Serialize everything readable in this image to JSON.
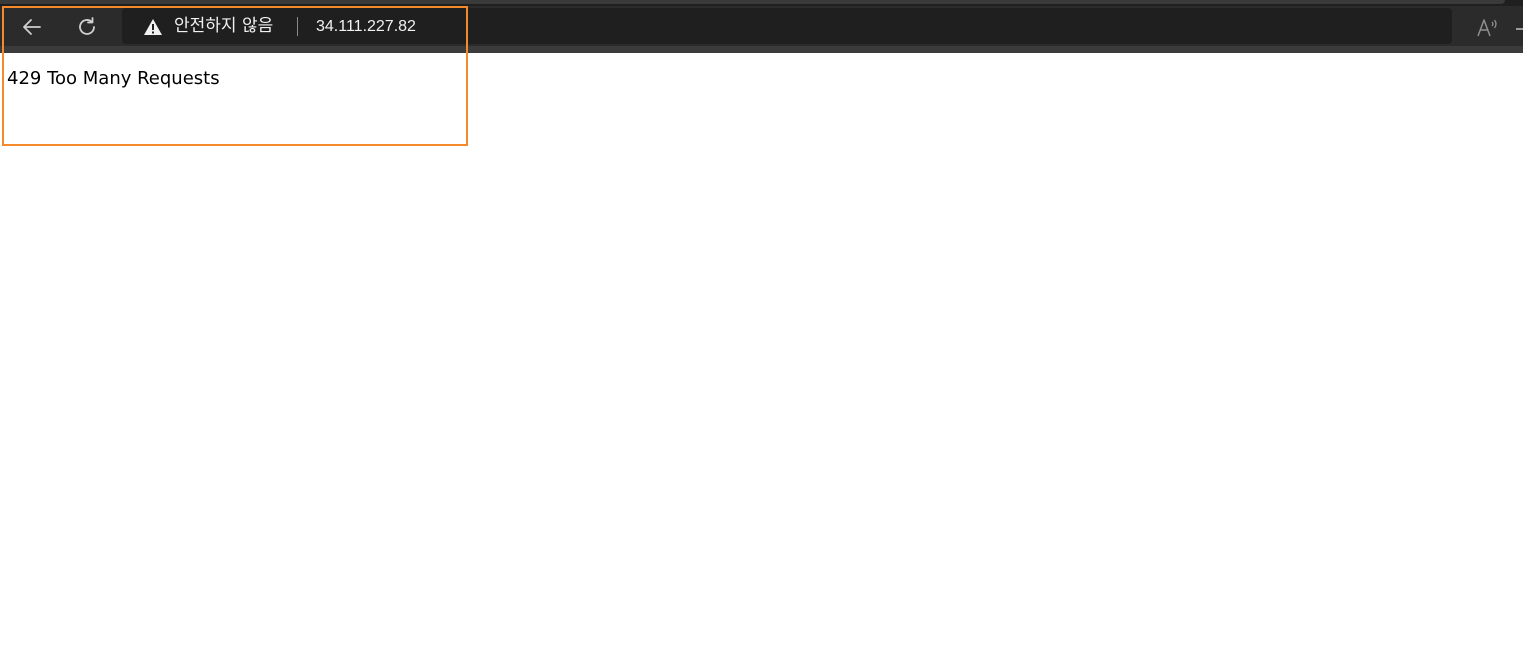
{
  "browser": {
    "security_label": "안전하지 않음",
    "url": "34.111.227.82",
    "icons": {
      "back": "back-arrow-icon",
      "refresh": "refresh-icon",
      "warning": "warning-triangle-icon",
      "read_aloud": "read-aloud-icon"
    }
  },
  "page": {
    "message": "429 Too Many Requests"
  },
  "colors": {
    "toolbar": "#2b2b2b",
    "address_bar": "#1f1f1f",
    "highlight": "#f58a2a",
    "page_bg": "#ffffff"
  }
}
